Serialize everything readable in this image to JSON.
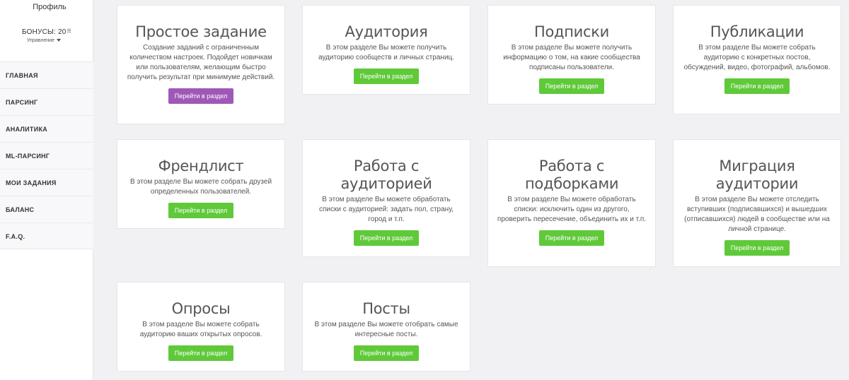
{
  "sidebar": {
    "profile": "Профиль",
    "bonus": "БОНУСЫ: 20",
    "coin": "☰",
    "manage": "Управление",
    "items": [
      {
        "label": "ГЛАВНАЯ"
      },
      {
        "label": "ПАРСИНГ"
      },
      {
        "label": "АНАЛИТИКА"
      },
      {
        "label": "ML-ПАРСИНГ"
      },
      {
        "label": "МОИ ЗАДАНИЯ"
      },
      {
        "label": "БАЛАНС"
      },
      {
        "label": "F.A.Q."
      }
    ]
  },
  "cards": [
    {
      "title": "Простое задание",
      "desc": "Создание заданий с ограниченным количеством настроек. Подойдет новичкам или пользователям, желающим быстро получить результат при минимуме действий.",
      "button": "Перейти в раздел",
      "button_color": "#a058b8"
    },
    {
      "title": "Аудитория",
      "desc": "В этом разделе Вы можете получить аудиторию сообществ и личных страниц.",
      "button": "Перейти в раздел",
      "button_color": "#5fc93a"
    },
    {
      "title": "Подписки",
      "desc": "В этом разделе Вы можете получить информацию о том, на какие сообщества подписаны пользователи.",
      "button": "Перейти в раздел",
      "button_color": "#5fc93a"
    },
    {
      "title": "Публикации",
      "desc": "В этом разделе Вы можете собрать аудиторию с конкретных постов, обсуждений, видео, фотографий, альбомов.",
      "button": "Перейти в раздел",
      "button_color": "#5fc93a"
    },
    {
      "title": "Френдлист",
      "desc": "В этом разделе Вы можете собрать друзей определенных пользователей.",
      "button": "Перейти в раздел",
      "button_color": "#5fc93a"
    },
    {
      "title": "Работа с аудиторией",
      "desc": "В этом разделе Вы можете обработать списки с аудиторией: задать пол, страну, город и т.п.",
      "button": "Перейти в раздел",
      "button_color": "#5fc93a"
    },
    {
      "title": "Работа с подборками",
      "desc": "В этом разделе Вы можете обработать списки: исключить один из другого, проверить пересечение, объединить их и т.п.",
      "button": "Перейти в раздел",
      "button_color": "#5fc93a"
    },
    {
      "title": "Миграция аудитории",
      "desc": "В этом разделе Вы можете отследить вступивших (подписавшихся) и вышедших (отписавшихся) людей в сообществе или на личной странице.",
      "button": "Перейти в раздел",
      "button_color": "#5fc93a"
    },
    {
      "title": "Опросы",
      "desc": "В этом разделе Вы можете собрать аудиторию ваших открытых опросов.",
      "button": "Перейти в раздел",
      "button_color": "#5fc93a"
    },
    {
      "title": "Посты",
      "desc": "В этом разделе Вы можете отобрать самые интересные посты.",
      "button": "Перейти в раздел",
      "button_color": "#5fc93a"
    }
  ]
}
